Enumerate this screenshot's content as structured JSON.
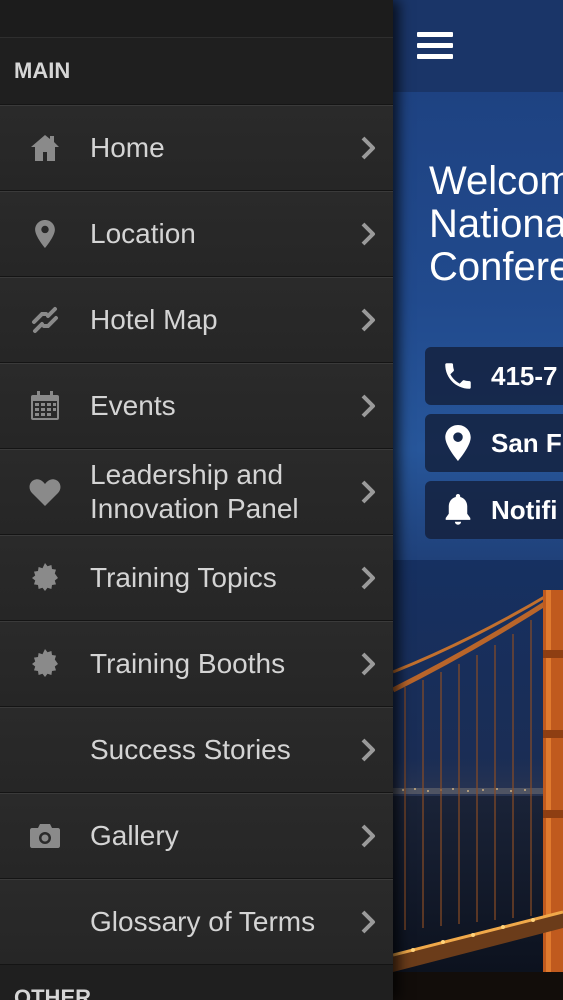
{
  "content": {
    "welcome_lines": [
      "Welcome to the",
      "National",
      "Conference"
    ],
    "contacts": {
      "phone": "415-7",
      "location": "San F",
      "notifications": "Notifi"
    }
  },
  "sidebar": {
    "main_section": "MAIN",
    "items": [
      {
        "label": "Home",
        "icon": "home-icon"
      },
      {
        "label": "Location",
        "icon": "map-pin-icon"
      },
      {
        "label": "Hotel Map",
        "icon": "link-icon"
      },
      {
        "label": "Events",
        "icon": "calendar-icon"
      },
      {
        "label": "Leadership and Innovation Panel",
        "icon": "heart-icon"
      },
      {
        "label": "Training Topics",
        "icon": "badge-icon"
      },
      {
        "label": "Training Booths",
        "icon": "badge-icon"
      },
      {
        "label": "Success Stories",
        "icon": ""
      },
      {
        "label": "Gallery",
        "icon": "camera-icon"
      },
      {
        "label": "Glossary of Terms",
        "icon": ""
      }
    ],
    "other_section": "OTHER"
  },
  "colors": {
    "drawer_bg": "#232323",
    "content_blue": "#214a8d",
    "text_light": "#d4d4d4"
  }
}
